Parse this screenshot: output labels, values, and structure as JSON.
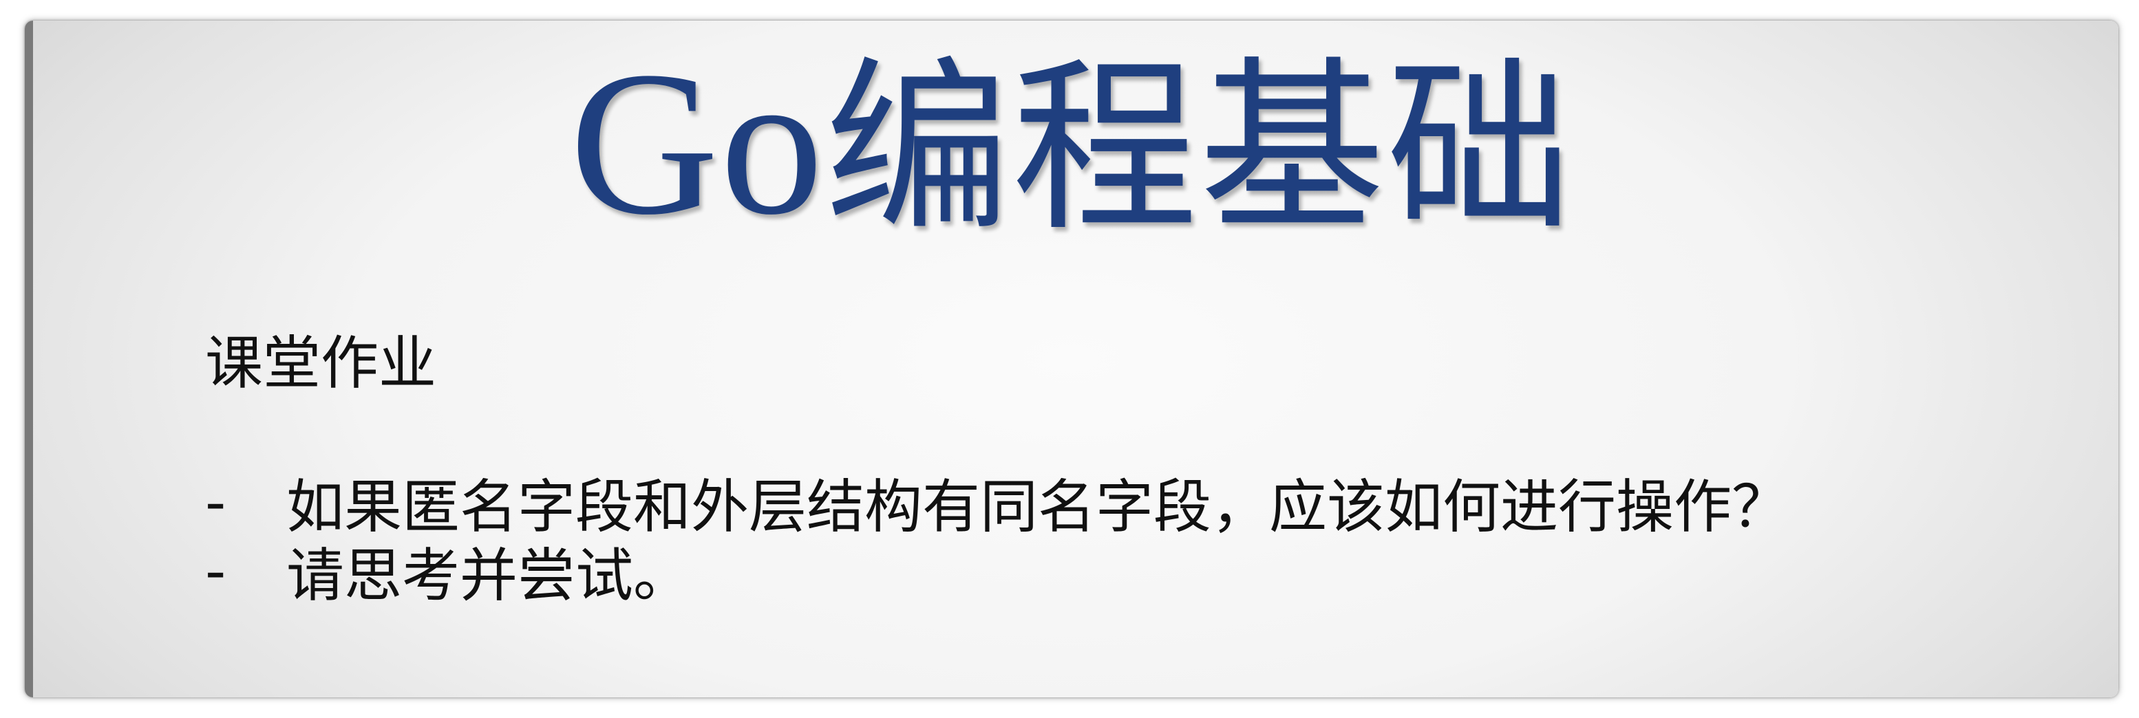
{
  "slide": {
    "title_latin": "Go",
    "title_cn": "编程基础",
    "heading": "课堂作业",
    "bullets": [
      {
        "marker": "-",
        "text": "如果匿名字段和外层结构有同名字段，应该如何进行操作？"
      },
      {
        "marker": "-",
        "text": "请思考并尝试。"
      }
    ],
    "colors": {
      "title": "#1f3f7f",
      "body_text": "#111111",
      "left_bar": "#7a7a7a"
    }
  }
}
